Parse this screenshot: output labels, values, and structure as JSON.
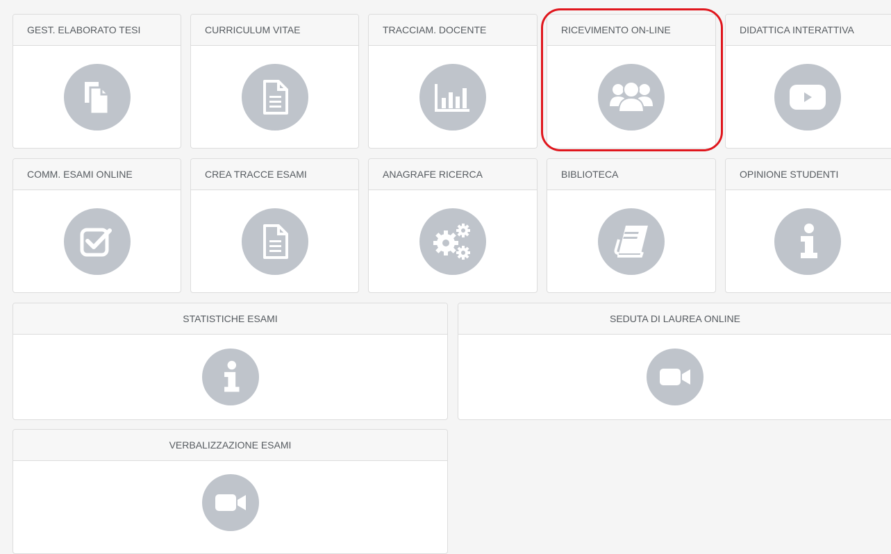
{
  "tiles": [
    {
      "label": "GEST. ELABORATO TESI",
      "icon": "copy-icon"
    },
    {
      "label": "CURRICULUM VITAE",
      "icon": "document-icon"
    },
    {
      "label": "TRACCIAM. DOCENTE",
      "icon": "bar-chart-icon"
    },
    {
      "label": "RICEVIMENTO ON-LINE",
      "icon": "users-icon"
    },
    {
      "label": "DIDATTICA INTERATTIVA",
      "icon": "play-icon"
    },
    {
      "label": "COMM. ESAMI ONLINE",
      "icon": "checkbox-icon"
    },
    {
      "label": "CREA TRACCE ESAMI",
      "icon": "document-icon"
    },
    {
      "label": "ANAGRAFE RICERCA",
      "icon": "gears-icon"
    },
    {
      "label": "BIBLIOTECA",
      "icon": "book-icon"
    },
    {
      "label": "OPINIONE STUDENTI",
      "icon": "info-icon"
    },
    {
      "label": "STATISTICHE ESAMI",
      "icon": "info-icon"
    },
    {
      "label": "SEDUTA DI LAUREA ONLINE",
      "icon": "video-camera-icon"
    },
    {
      "label": "VERBALIZZAZIONE ESAMI",
      "icon": "video-camera-icon"
    }
  ],
  "colors": {
    "icon_circle": "#bfc4cb",
    "highlight": "#e0161d",
    "background": "#f5f5f5"
  }
}
